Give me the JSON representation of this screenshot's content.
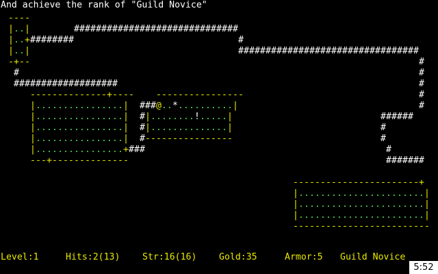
{
  "message": "And achieve the rank of \"Guild Novice\"",
  "colors": {
    "wall": "#e8e800",
    "floor": "#4fd84f",
    "corridor": "#ffffff",
    "door": "#e8e800",
    "player": "#e8e800",
    "item": "#ffffff",
    "status": "#e8e800",
    "text": "#ffffff"
  },
  "legend": {
    "-": "wall",
    "|": "wall",
    "+": "door",
    ".": "floor",
    "#": "corridor",
    "@": "player",
    "*": "item",
    "!": "item"
  },
  "map": [
    " ----",
    " |..|        ##############################",
    " |..+########                              #",
    " |..|                                      #################################",
    " -+--                                                                       #",
    "  #                                                                         #",
    "  ###################                                                       #",
    "     --------------+----    ----------------                                #",
    "     |................|  ###@..*..........|                                 #",
    "     |................|  #|........!.....|                           ######",
    "     |................|  #|..............|                           #",
    "     |................|  #----------------                           #",
    "     |................+###                                            #",
    "     ---+--------------                                               #######",
    "                                                                            ",
    "                                                     -----------------------+",
    "                                                     |.......................|",
    "                                                     |.......................|",
    "                                                     |.......................|",
    "                                                     -------------------------"
  ],
  "status": {
    "level": "Level:1",
    "hits": "Hits:2(13)",
    "str": "Str:16(16)",
    "gold": "Gold:35",
    "armor": "Armor:5",
    "rank": "Guild Novice"
  },
  "clock": "5:52"
}
